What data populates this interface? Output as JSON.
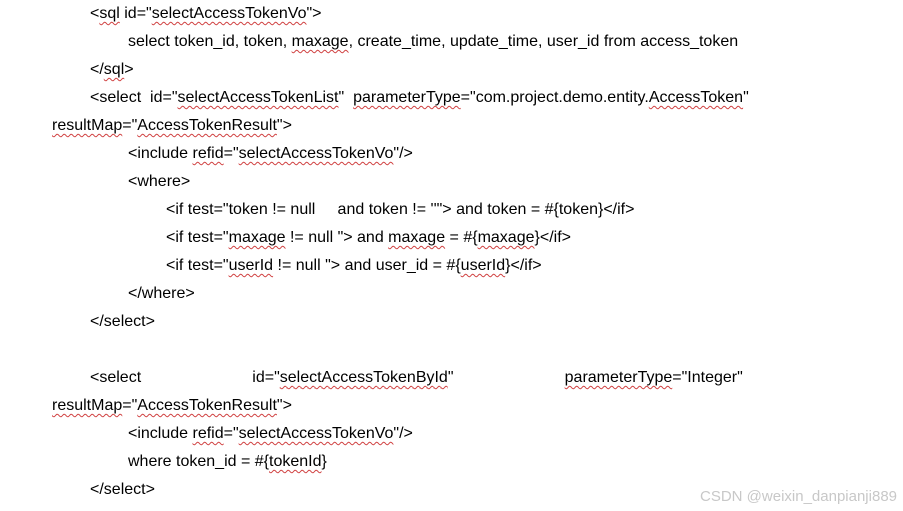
{
  "lines": [
    {
      "indent": 1,
      "segments": [
        {
          "t": "<"
        },
        {
          "t": "sql",
          "sq": true
        },
        {
          "t": " id=\""
        },
        {
          "t": "selectAccessTokenVo",
          "sq": true
        },
        {
          "t": "\">"
        }
      ]
    },
    {
      "indent": 2,
      "segments": [
        {
          "t": "select token_id, token, "
        },
        {
          "t": "maxage",
          "sq": true
        },
        {
          "t": ", create_time, update_time, user_id from access_token"
        }
      ]
    },
    {
      "indent": 1,
      "segments": [
        {
          "t": "</"
        },
        {
          "t": "sql",
          "sq": true
        },
        {
          "t": ">"
        }
      ]
    },
    {
      "indent": 1,
      "segments": [
        {
          "t": "<select  id=\""
        },
        {
          "t": "selectAccessTokenList",
          "sq": true
        },
        {
          "t": "\"  "
        },
        {
          "t": "parameterType",
          "sq": true
        },
        {
          "t": "=\"com.project.demo.entity."
        },
        {
          "t": "AccessToken",
          "sq": true
        },
        {
          "t": "\""
        }
      ]
    },
    {
      "indent": 0,
      "segments": [
        {
          "t": "resultMap",
          "sq": true
        },
        {
          "t": "=\""
        },
        {
          "t": "AccessTokenResult",
          "sq": true
        },
        {
          "t": "\">"
        }
      ]
    },
    {
      "indent": 2,
      "segments": [
        {
          "t": "<include "
        },
        {
          "t": "refid",
          "sq": true
        },
        {
          "t": "=\""
        },
        {
          "t": "selectAccessTokenVo",
          "sq": true
        },
        {
          "t": "\"/>"
        }
      ]
    },
    {
      "indent": 2,
      "segments": [
        {
          "t": "<where>"
        }
      ]
    },
    {
      "indent": 3,
      "segments": [
        {
          "t": "<if test=\"token != null     and token != ''\"> and token = #{token}</if>"
        }
      ]
    },
    {
      "indent": 3,
      "segments": [
        {
          "t": "<if test=\""
        },
        {
          "t": "maxage",
          "sq": true
        },
        {
          "t": " != null \"> and "
        },
        {
          "t": "maxage",
          "sq": true
        },
        {
          "t": " = #{"
        },
        {
          "t": "maxage",
          "sq": true
        },
        {
          "t": "}</if>"
        }
      ]
    },
    {
      "indent": 3,
      "segments": [
        {
          "t": "<if test=\""
        },
        {
          "t": "userId",
          "sq": true
        },
        {
          "t": " != null \"> and user_id = #{"
        },
        {
          "t": "userId",
          "sq": true
        },
        {
          "t": "}</if>"
        }
      ]
    },
    {
      "indent": 2,
      "segments": [
        {
          "t": "</where>"
        }
      ]
    },
    {
      "indent": 1,
      "segments": [
        {
          "t": "</select>"
        }
      ]
    },
    {
      "indent": 1,
      "segments": [
        {
          "t": "<select                         id=\""
        },
        {
          "t": "selectAccessTokenById",
          "sq": true
        },
        {
          "t": "\"                         "
        },
        {
          "t": "parameterType",
          "sq": true
        },
        {
          "t": "=\"Integer\""
        }
      ]
    },
    {
      "indent": 0,
      "segments": [
        {
          "t": "resultMap",
          "sq": true
        },
        {
          "t": "=\""
        },
        {
          "t": "AccessTokenResult",
          "sq": true
        },
        {
          "t": "\">"
        }
      ]
    },
    {
      "indent": 2,
      "segments": [
        {
          "t": "<include "
        },
        {
          "t": "refid",
          "sq": true
        },
        {
          "t": "=\""
        },
        {
          "t": "selectAccessTokenVo",
          "sq": true
        },
        {
          "t": "\"/>"
        }
      ]
    },
    {
      "indent": 2,
      "segments": [
        {
          "t": "where token_id = #{"
        },
        {
          "t": "tokenId",
          "sq": true
        },
        {
          "t": "}"
        }
      ]
    },
    {
      "indent": 1,
      "segments": [
        {
          "t": "</select>"
        }
      ]
    }
  ],
  "watermark": "CSDN @weixin_danpianji889"
}
